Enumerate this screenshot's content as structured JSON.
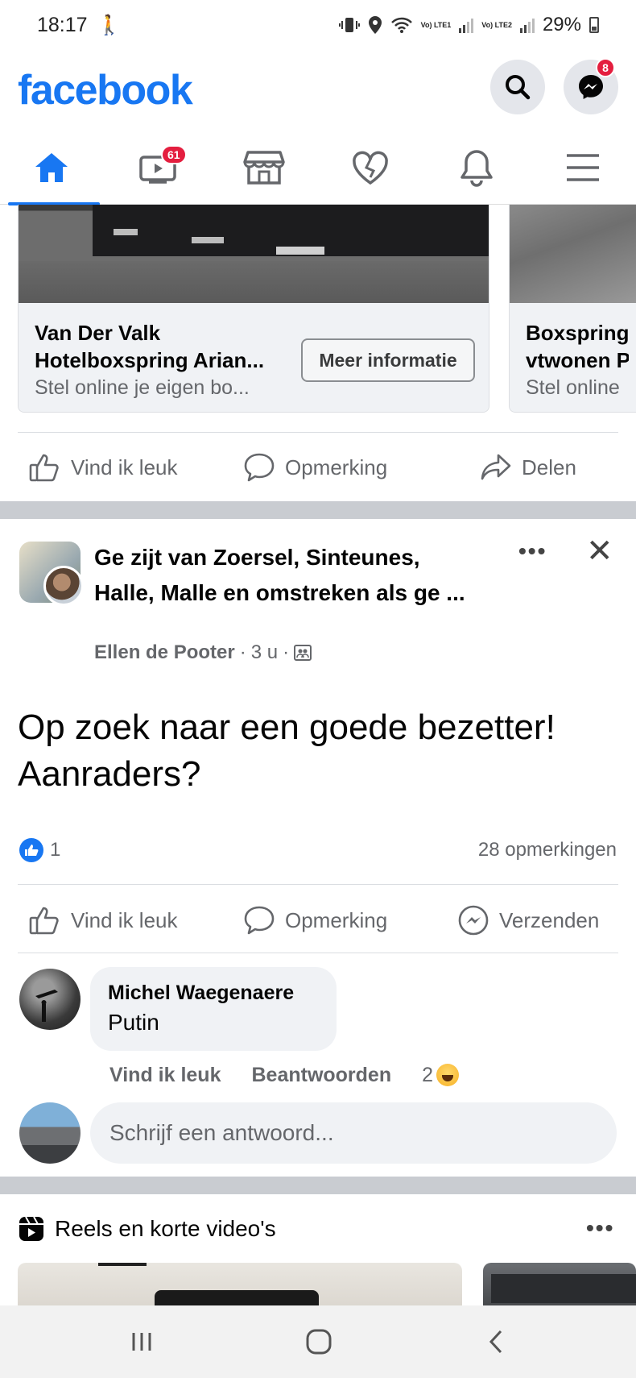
{
  "status_bar": {
    "time": "18:17",
    "network_1": "Vo) LTE1",
    "network_2": "Vo) LTE2",
    "battery": "29%"
  },
  "header": {
    "logo": "facebook",
    "messenger_badge": "8"
  },
  "tabs": [
    {
      "name": "home",
      "icon": "home-icon",
      "active": true
    },
    {
      "name": "watch",
      "icon": "video-icon",
      "badge": "61"
    },
    {
      "name": "marketplace",
      "icon": "store-icon"
    },
    {
      "name": "dating",
      "icon": "heart-icon"
    },
    {
      "name": "notifications",
      "icon": "bell-icon"
    },
    {
      "name": "menu",
      "icon": "hamburger-icon"
    }
  ],
  "ad_carousel": {
    "cards": [
      {
        "title_1": "Van Der Valk",
        "title_2": "Hotelboxspring Arian...",
        "subtitle": "Stel online je eigen bo...",
        "cta": "Meer informatie"
      },
      {
        "title_1": "Boxspring",
        "title_2": "vtwonen P",
        "subtitle": "Stel online"
      }
    ]
  },
  "ad_actions": {
    "like": "Vind ik leuk",
    "comment": "Opmerking",
    "share": "Delen"
  },
  "post": {
    "group_title": "Ge zijt van Zoersel, Sinteunes, Halle, Malle en omstreken  als ge ...",
    "author": "Ellen de Pooter",
    "time": "3 u",
    "text": "Op zoek naar een goede bezetter! Aanraders?",
    "like_count": "1",
    "comment_count": "28 opmerkingen",
    "actions": {
      "like": "Vind ik leuk",
      "comment": "Opmerking",
      "send": "Verzenden"
    }
  },
  "comment": {
    "name": "Michel Waegenaere",
    "text": "Putin",
    "like_link": "Vind ik leuk",
    "reply_link": "Beantwoorden",
    "reaction_count": "2"
  },
  "reply_box": {
    "placeholder": "Schrijf een antwoord..."
  },
  "reels": {
    "title": "Reels en korte video's"
  },
  "colors": {
    "brand": "#1877f2",
    "badge": "#e41e3f",
    "secondary_text": "#65676b"
  }
}
